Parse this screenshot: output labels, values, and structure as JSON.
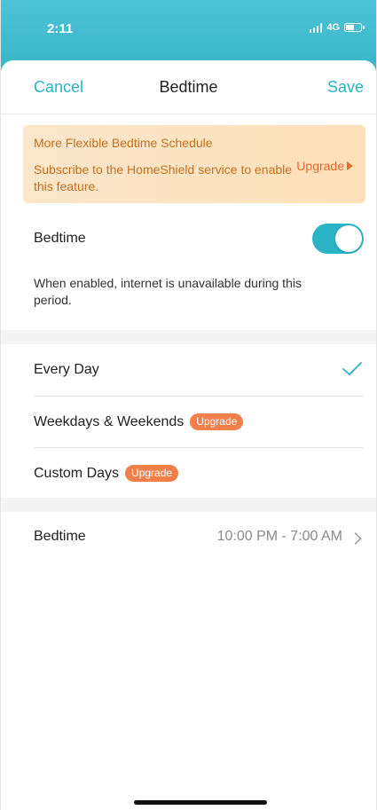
{
  "status_bar": {
    "time": "2:11",
    "network": "4G",
    "battery_level": 0.6
  },
  "nav": {
    "cancel": "Cancel",
    "title": "Bedtime",
    "save": "Save"
  },
  "banner": {
    "title": "More Flexible Bedtime Schedule",
    "text": "Subscribe to the HomeShield service to enable this feature.",
    "upgrade": "Upgrade"
  },
  "bedtime_toggle": {
    "label": "Bedtime",
    "enabled": true,
    "description": "When enabled, internet is unavailable during this period."
  },
  "schedule_options": [
    {
      "label": "Every Day",
      "selected": true,
      "badge": ""
    },
    {
      "label": "Weekdays & Weekends",
      "selected": false,
      "badge": "Upgrade"
    },
    {
      "label": "Custom Days",
      "selected": false,
      "badge": "Upgrade"
    }
  ],
  "bedtime_period": {
    "label": "Bedtime",
    "value": "10:00 PM - 7:00 AM"
  },
  "colors": {
    "accent": "#2ab4c5",
    "upgrade_badge": "#f07f4c",
    "banner_text": "#c76f1f"
  },
  "icons": {
    "check": "checkmark-icon",
    "chevron": "chevron-right-icon",
    "banner_arrow": "triangle-right-icon"
  }
}
